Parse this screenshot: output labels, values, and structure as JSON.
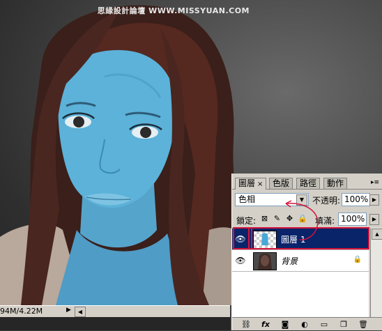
{
  "watermark": "思緣設計論壇  WWW.MISSYUAN.COM",
  "status": {
    "doc_size": "94M/4.22M"
  },
  "panel": {
    "tabs": [
      "圖層",
      "色版",
      "路徑",
      "動作"
    ],
    "blend_mode": "色相",
    "opacity_label": "不透明:",
    "opacity_value": "100%",
    "lock_label": "鎖定:",
    "fill_label": "填滿:",
    "fill_value": "100%",
    "layers": [
      {
        "name": "圖層 1",
        "selected": true
      },
      {
        "name": "背景",
        "selected": false
      }
    ],
    "accent_color": "#d4143a",
    "selection_color": "#0a246a"
  },
  "icons": [
    "eye-icon",
    "link-icon",
    "fx-icon",
    "mask-icon",
    "adjustment-icon",
    "folder-icon",
    "new-layer-icon",
    "trash-icon"
  ]
}
